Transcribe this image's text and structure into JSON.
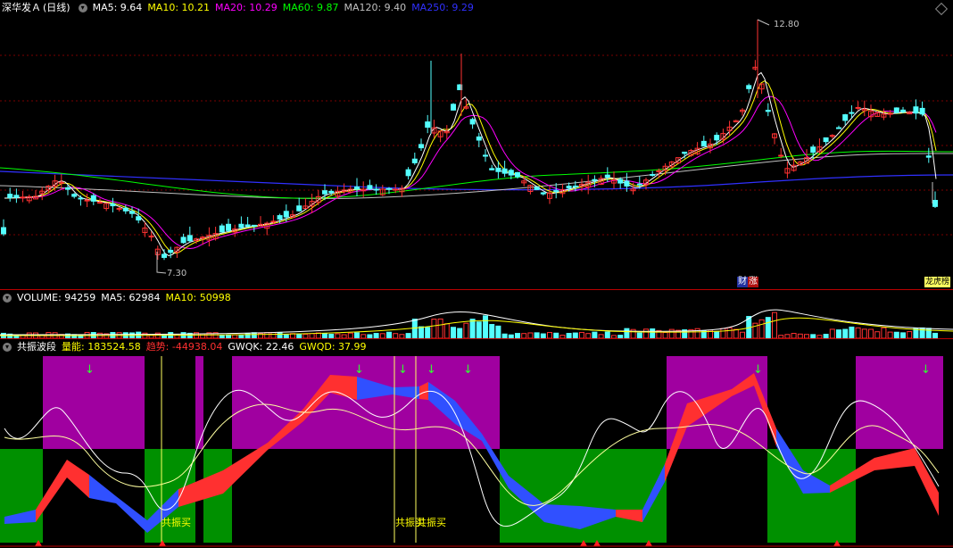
{
  "main": {
    "stock_name": "深华发Ａ",
    "period": "(日线)",
    "ma": [
      {
        "label": "MA5: 9.64",
        "color": "#ffffff"
      },
      {
        "label": "MA10: 10.21",
        "color": "#ffff00"
      },
      {
        "label": "MA20: 10.29",
        "color": "#ff00ff"
      },
      {
        "label": "MA60: 9.87",
        "color": "#00ff00"
      },
      {
        "label": "MA120: 9.40",
        "color": "#c0c0c0"
      },
      {
        "label": "MA250: 9.29",
        "color": "#3030ff"
      }
    ],
    "high_label": "12.80",
    "low_label": "7.30",
    "tag_left": "财",
    "tag_right": "涨",
    "tag_last": "龙虎榜"
  },
  "volume": {
    "label": "VOLUME: 94259",
    "ma5": "MA5: 62984",
    "ma10": "MA10: 50998"
  },
  "indicator": {
    "name": "共振波段",
    "energy": "量能: 183524.58",
    "trend": "趋势: -44938.04",
    "gwqk": "GWQK: 22.46",
    "gwqd": "GWQD: 37.99",
    "buy_label_1": "共振买",
    "buy_label_2": "共振买",
    "buy_label_3": "共振买"
  },
  "colors": {
    "up": "#ff3232",
    "down": "#54ffff",
    "grid": "#8b0000",
    "zone_top": "#a000a0",
    "zone_bottom": "#009000"
  },
  "icons": [
    "diamond-icon",
    "collapse-icon",
    "arrow-down-icon",
    "arrow-up-icon"
  ]
}
